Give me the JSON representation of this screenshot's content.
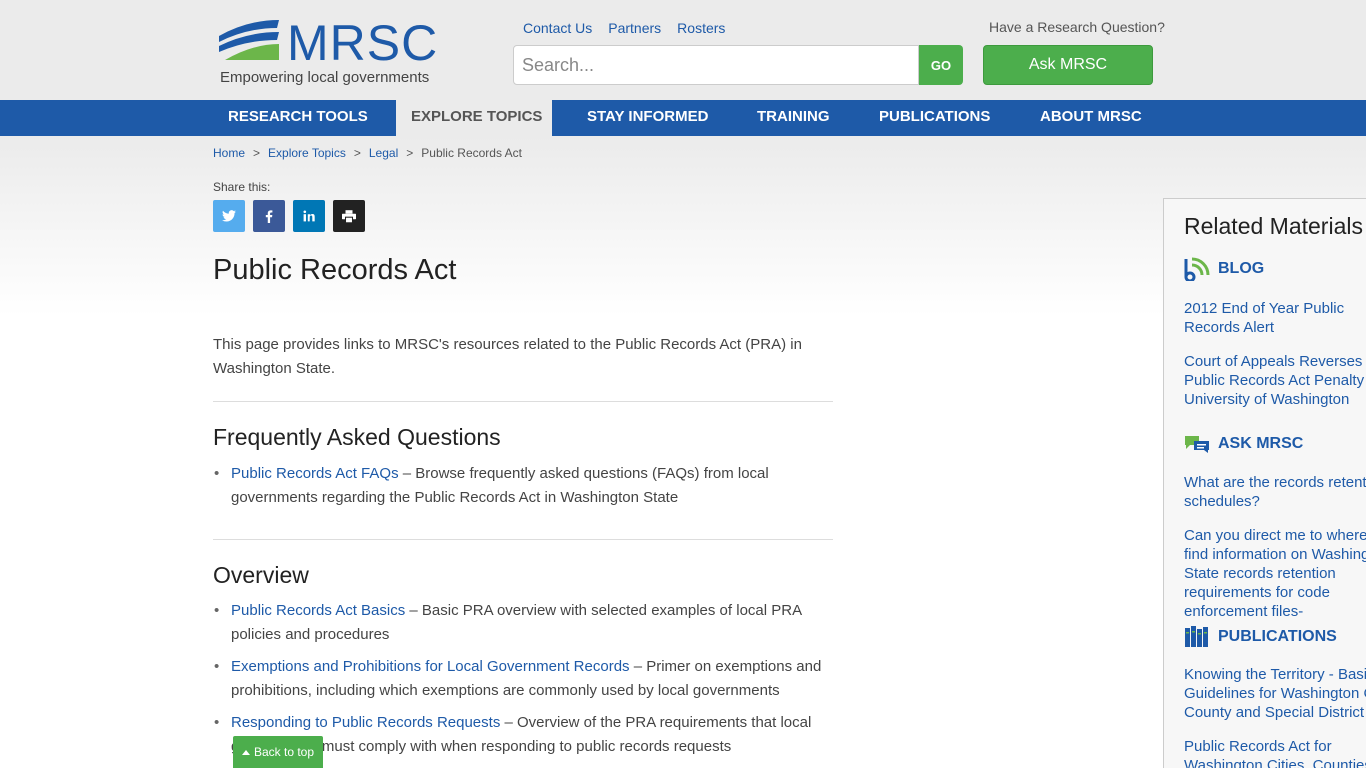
{
  "header": {
    "logo_text": "MRSC",
    "tagline": "Empowering local governments",
    "top_links": [
      "Contact Us",
      "Partners",
      "Rosters"
    ],
    "search_placeholder": "Search...",
    "go_label": "GO",
    "research_question": "Have a Research Question?",
    "ask_label": "Ask MRSC"
  },
  "nav": {
    "items": [
      "RESEARCH TOOLS",
      "EXPLORE TOPICS",
      "STAY INFORMED",
      "TRAINING",
      "PUBLICATIONS",
      "ABOUT MRSC"
    ],
    "active": "EXPLORE TOPICS"
  },
  "breadcrumb": [
    "Home",
    "Explore Topics",
    "Legal",
    "Public Records Act"
  ],
  "breadcrumb_sep": ">",
  "share": {
    "label": "Share this:",
    "buttons": [
      {
        "name": "twitter",
        "glyph": "t",
        "color": "#55acee"
      },
      {
        "name": "facebook",
        "glyph": "f",
        "color": "#3b5998"
      },
      {
        "name": "linkedin",
        "glyph": "in",
        "color": "#0077b5"
      },
      {
        "name": "print",
        "glyph": "print",
        "color": "#222222"
      }
    ]
  },
  "main": {
    "title": "Public Records Act",
    "intro": "This page provides links to MRSC's resources related to the Public Records Act (PRA) in Washington State.",
    "faq_heading": "Frequently Asked Questions",
    "faq_items": [
      {
        "link": "Public Records Act FAQs",
        "desc": " – Browse frequently asked questions (FAQs) from local governments regarding the Public Records Act in Washington State"
      }
    ],
    "overview_heading": "Overview",
    "overview_items": [
      {
        "link": "Public Records Act Basics",
        "desc": " – Basic PRA overview with selected examples of local PRA policies and procedures"
      },
      {
        "link": "Exemptions and Prohibitions for Local Government Records",
        "desc": " – Primer on exemptions and prohibitions, including which exemptions are commonly used by local governments"
      },
      {
        "link": "Responding to Public Records Requests",
        "desc": " – Overview of the PRA requirements that local governments must comply with when responding to public records requests"
      }
    ]
  },
  "back_to_top": "Back to top",
  "sidebar": {
    "title": "Related Materials",
    "blog_heading": "BLOG",
    "blog_items": [
      "2012 End of Year Public Records Alert",
      "Court of Appeals Reverses Public Records Act Penalty on University of Washington"
    ],
    "ask_heading": "ASK MRSC",
    "ask_items": [
      " What are the records retention schedules?",
      "Can you direct me to where to find information on Washington State records retention requirements for code enforcement files-"
    ],
    "pub_heading": "PUBLICATIONS",
    "pub_items": [
      "Knowing the Territory - Basic Guidelines for Washington City, County and Special District",
      "Public Records Act for Washington Cities, Counties, and Special"
    ]
  },
  "colors": {
    "brand_blue": "#1e5aa8",
    "accent_green": "#4cae4c",
    "header_bg": "#ebebeb"
  }
}
